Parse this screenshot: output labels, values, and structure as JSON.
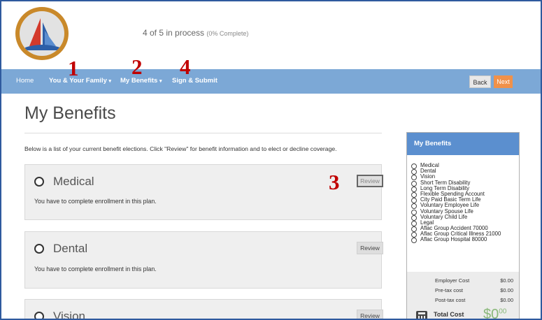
{
  "header": {
    "progress_text": "4 of 5 in process",
    "progress_sub": "(0% Complete)"
  },
  "nav": {
    "home": "Home",
    "you_family": "You & Your Family",
    "my_benefits": "My Benefits",
    "sign_submit": "Sign & Submit",
    "back": "Back",
    "next": "Next",
    "caret": "▾"
  },
  "annotations": [
    "1",
    "2",
    "4",
    "3"
  ],
  "page": {
    "title": "My Benefits",
    "intro": "Below is a list of your current benefit elections.  Click \"Review\" for benefit information and to elect or decline coverage."
  },
  "cards": [
    {
      "title": "Medical",
      "text": "You have to complete enrollment in this plan.",
      "button": "Review"
    },
    {
      "title": "Dental",
      "text": "You have to complete enrollment in this plan.",
      "button": "Review"
    },
    {
      "title": "Vision",
      "text": "",
      "button": "Review"
    }
  ],
  "sidebar": {
    "title": "My Benefits",
    "items": [
      "Medical",
      "Dental",
      "Vision",
      "Short Term Disability",
      "Long Term Disability",
      "Flexible Spending Account",
      "City Paid Basic Term Life",
      "Voluntary Employee Life",
      "Voluntary Spouse Life",
      "Voluntary Child Life",
      "Legal",
      "Aflac Group Accident 70000",
      "Aflac Group Critical Illness 21000",
      "Aflac Group Hospital 80000"
    ],
    "costs": [
      {
        "label": "Employer Cost",
        "value": "$0.00"
      },
      {
        "label": "Pre-tax cost",
        "value": "$0.00"
      },
      {
        "label": "Post-tax cost",
        "value": "$0.00"
      }
    ],
    "total_label": "Total Cost",
    "total_main": "$0",
    "total_cents": "00"
  },
  "colors": {
    "navbar": "#7ca8d6",
    "next_button": "#f0914a",
    "sidebar_header": "#5b8fcf",
    "annotation": "#c00000",
    "total": "#8ab87a"
  }
}
